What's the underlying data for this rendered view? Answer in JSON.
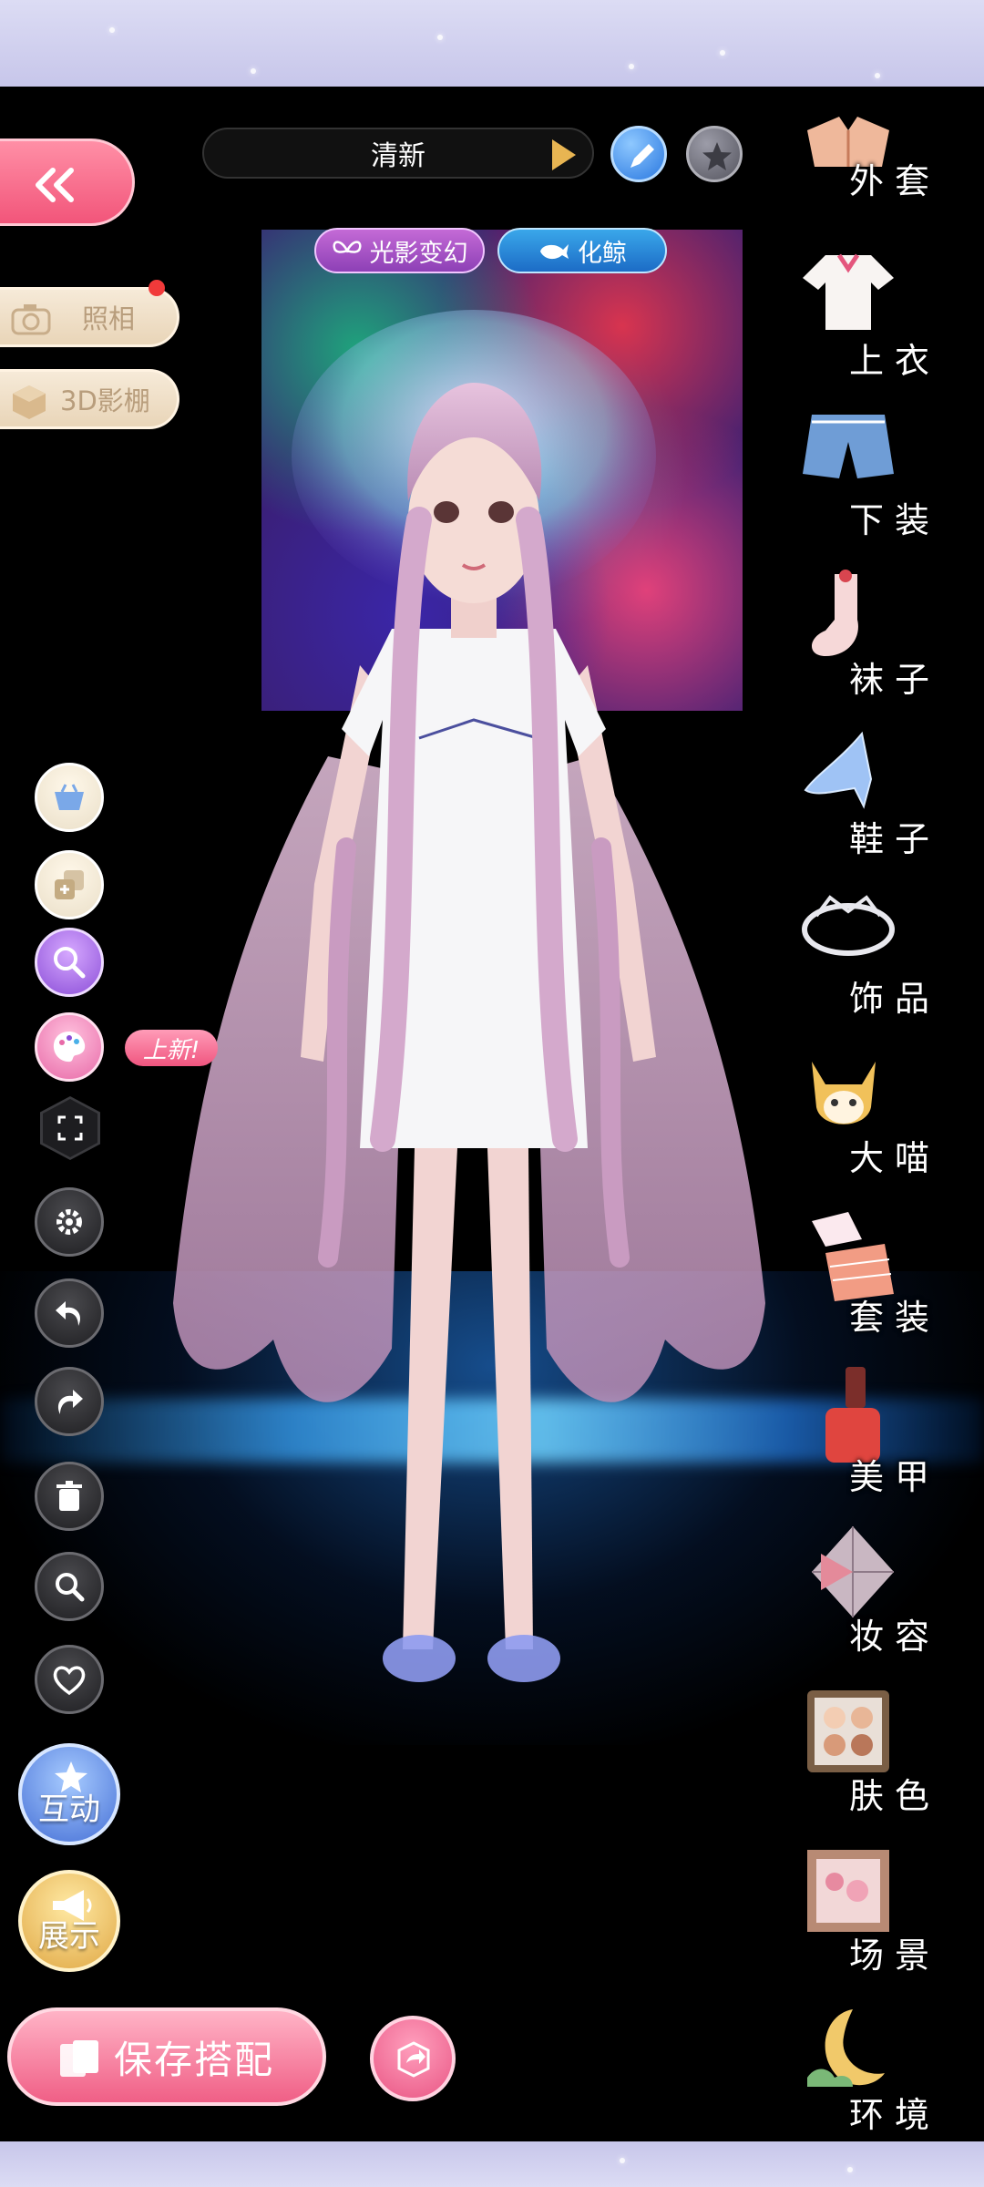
{
  "outfit": {
    "name": "清新"
  },
  "effects": {
    "light_label": "光影变幻",
    "whale_label": "化鲸"
  },
  "left_panel": {
    "photo_label": "照相",
    "studio_label": "3D影棚",
    "new_badge": "上新!",
    "interact_label": "互动",
    "show_label": "展示",
    "save_label": "保存搭配"
  },
  "categories": [
    {
      "label": "外套",
      "icon": "coat-icon"
    },
    {
      "label": "上衣",
      "icon": "top-icon"
    },
    {
      "label": "下装",
      "icon": "shorts-icon"
    },
    {
      "label": "袜子",
      "icon": "sock-icon"
    },
    {
      "label": "鞋子",
      "icon": "shoe-icon"
    },
    {
      "label": "饰品",
      "icon": "tiara-icon"
    },
    {
      "label": "大喵",
      "icon": "cat-icon"
    },
    {
      "label": "套装",
      "icon": "outfit-set-icon"
    },
    {
      "label": "美甲",
      "icon": "nail-polish-icon"
    },
    {
      "label": "妆容",
      "icon": "makeup-icon"
    },
    {
      "label": "肤色",
      "icon": "skin-palette-icon"
    },
    {
      "label": "场景",
      "icon": "scene-frame-icon"
    },
    {
      "label": "环境",
      "icon": "moon-environment-icon"
    }
  ],
  "colors": {
    "accent_pink": "#f2557a",
    "namebar_arrow": "#e8b552",
    "background": "#000000"
  }
}
